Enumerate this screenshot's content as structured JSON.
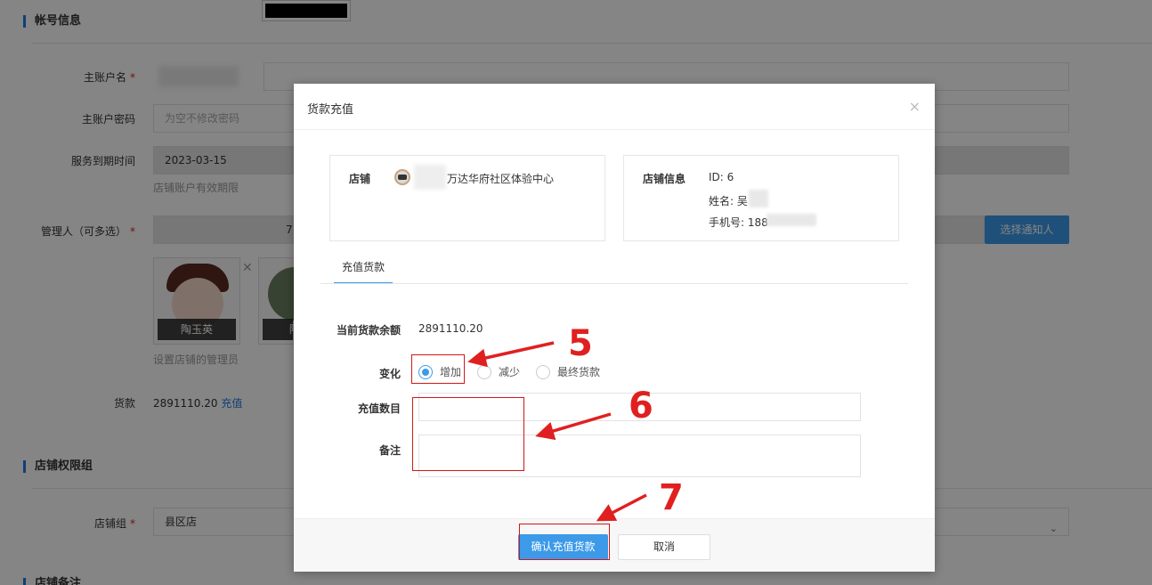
{
  "background": {
    "sections": {
      "account": "帐号信息",
      "permissions": "店铺权限组",
      "remarks": "店铺备注"
    },
    "fields": {
      "main_account_label": "主账户名",
      "main_password_label": "主账户密码",
      "main_password_placeholder": "为空不修改密码",
      "expire_label": "服务到期时间",
      "expire_value": "2023-03-15",
      "expire_hint": "店铺账户有效期限",
      "manager_label": "管理人（可多选）",
      "manager_value_tail": "7",
      "notify_button": "选择通知人",
      "manager_hint": "设置店铺的管理员",
      "goods_label": "货款",
      "goods_value": "2891110.20",
      "recharge_link": "充值",
      "store_group_label": "店铺组",
      "store_group_value": "县区店"
    },
    "managers": [
      {
        "name": "陶玉英"
      },
      {
        "name": "陶"
      }
    ],
    "required_mark": "*"
  },
  "modal": {
    "title": "货款充值",
    "close_glyph": "×",
    "store_label": "店铺",
    "store_name": "万达华府社区体验中心",
    "store_info_label": "店铺信息",
    "store_id": "ID: 6",
    "store_contact": "姓名: 吴",
    "store_phone": "手机号: 188",
    "tab": "充值货款",
    "balance_label": "当前货款余额",
    "balance_value": "2891110.20",
    "change_label": "变化",
    "change_options": [
      "增加",
      "减少",
      "最终货款"
    ],
    "change_selected": "增加",
    "amount_label": "充值数目",
    "amount_value": "",
    "remark_label": "备注",
    "remark_value": "",
    "confirm_button": "确认充值货款",
    "cancel_button": "取消"
  },
  "annotations": {
    "step5": "5",
    "step6": "6",
    "step7": "7",
    "color": "#e02020"
  },
  "colors": {
    "accent": "#3c9ae8",
    "section_bar": "#1f7ae0"
  }
}
